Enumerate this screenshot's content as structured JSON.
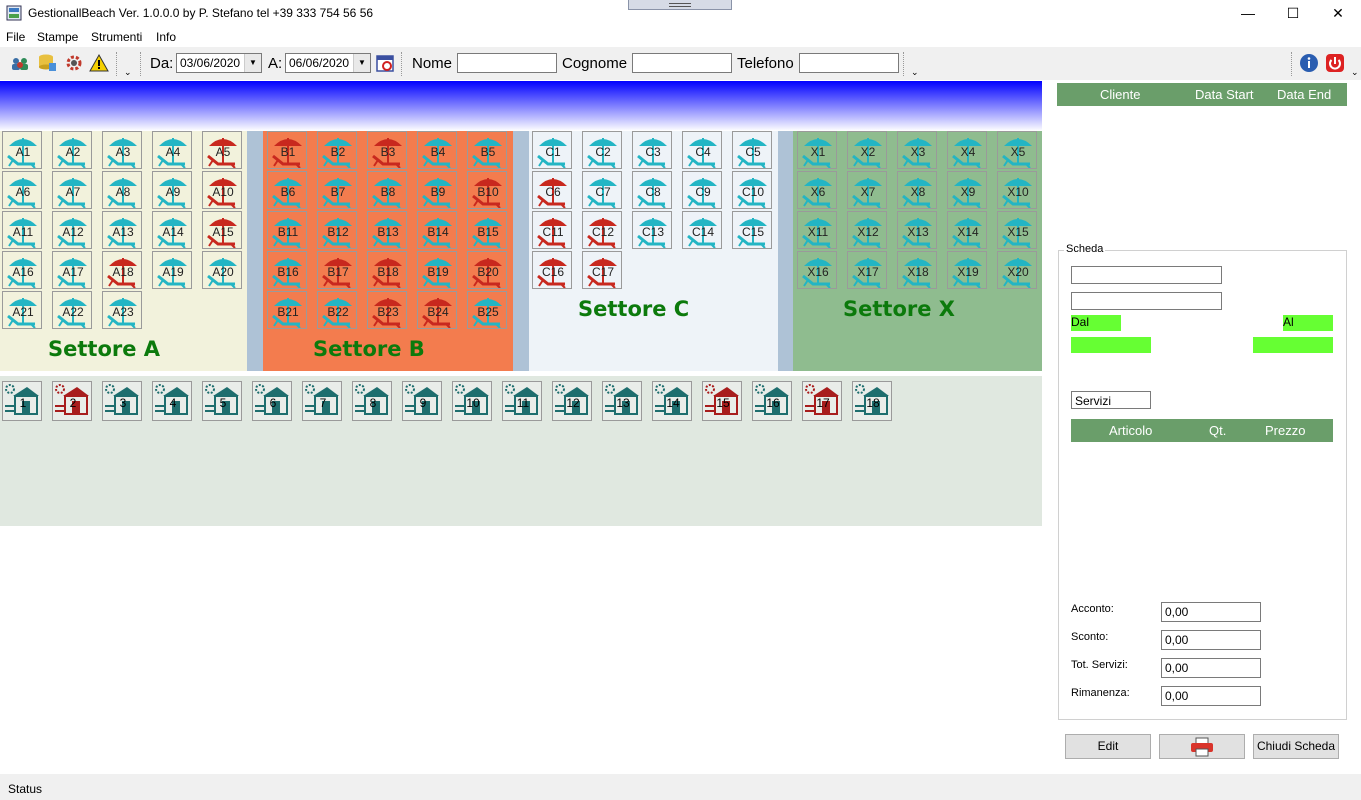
{
  "window": {
    "title": "GestionallBeach Ver. 1.0.0.0 by P. Stefano tel +39 333 754 56 56",
    "minimize": "—",
    "maximize": "☐",
    "close": "✕"
  },
  "menu": [
    "File",
    "Stampe",
    "Strumenti",
    "Info"
  ],
  "toolbar": {
    "da_label": "Da:",
    "da_value": "03/06/2020",
    "a_label": "A:",
    "a_value": "06/06/2020",
    "nome_label": "Nome",
    "cognome_label": "Cognome",
    "telefono_label": "Telefono",
    "nome_value": "",
    "cognome_value": "",
    "telefono_value": ""
  },
  "sectors": [
    {
      "key": "A",
      "label": "Settore A",
      "bg": "#f2f2dc",
      "rows": [
        [
          "A1",
          "A2",
          "A3",
          "A4",
          "A5"
        ],
        [
          "A6",
          "A7",
          "A8",
          "A9",
          "A10"
        ],
        [
          "A11",
          "A12",
          "A13",
          "A14",
          "A15"
        ],
        [
          "A16",
          "A17",
          "A18",
          "A19",
          "A20"
        ],
        [
          "A21",
          "A22",
          "A23"
        ]
      ],
      "occupied": [
        "A5",
        "A10",
        "A15",
        "A18"
      ]
    },
    {
      "key": "B",
      "label": "Settore B",
      "bg": "#f37c4e",
      "rows": [
        [
          "B1",
          "B2",
          "B3",
          "B4",
          "B5"
        ],
        [
          "B6",
          "B7",
          "B8",
          "B9",
          "B10"
        ],
        [
          "B11",
          "B12",
          "B13",
          "B14",
          "B15"
        ],
        [
          "B16",
          "B17",
          "B18",
          "B19",
          "B20"
        ],
        [
          "B21",
          "B22",
          "B23",
          "B24",
          "B25"
        ]
      ],
      "occupied": [
        "B1",
        "B3",
        "B10",
        "B17",
        "B18",
        "B20",
        "B23",
        "B24"
      ]
    },
    {
      "key": "C",
      "label": "Settore C",
      "bg": "#eef3f8",
      "rows": [
        [
          "C1",
          "C2",
          "C3",
          "C4",
          "C5"
        ],
        [
          "C6",
          "C7",
          "C8",
          "C9",
          "C10"
        ],
        [
          "C11",
          "C12",
          "C13",
          "C14",
          "C15"
        ],
        [
          "C16",
          "C17"
        ]
      ],
      "occupied": [
        "C6",
        "C11",
        "C12",
        "C16",
        "C17"
      ]
    },
    {
      "key": "X",
      "label": "Settore X",
      "bg": "#8fbc8f",
      "rows": [
        [
          "X1",
          "X2",
          "X3",
          "X4",
          "X5"
        ],
        [
          "X6",
          "X7",
          "X8",
          "X9",
          "X10"
        ],
        [
          "X11",
          "X12",
          "X13",
          "X14",
          "X15"
        ],
        [
          "X16",
          "X17",
          "X18",
          "X19",
          "X20"
        ]
      ],
      "occupied": []
    }
  ],
  "cabins": {
    "labels": [
      "1",
      "2",
      "3",
      "4",
      "5",
      "6",
      "7",
      "8",
      "9",
      "10",
      "11",
      "12",
      "13",
      "14",
      "15",
      "16",
      "17",
      "18"
    ],
    "occupied": [
      "2",
      "15",
      "17"
    ]
  },
  "reservations": {
    "columns": [
      "Cliente",
      "Data Start",
      "Data End"
    ]
  },
  "scheda": {
    "title": "Scheda",
    "field1": "",
    "field2": "",
    "dal_label": "Dal",
    "al_label": "Al",
    "dal_value": "",
    "al_value": "",
    "servizi_value": "Servizi",
    "articles_columns": [
      "Articolo",
      "Qt.",
      "Prezzo"
    ],
    "acconto_label": "Acconto:",
    "acconto_value": "0,00",
    "sconto_label": "Sconto:",
    "sconto_value": "0,00",
    "tot_servizi_label": "Tot. Servizi:",
    "tot_servizi_value": "0,00",
    "rimanenza_label": "Rimanenza:",
    "rimanenza_value": "0,00"
  },
  "buttons": {
    "edit": "Edit",
    "chiudi": "Chiudi Scheda"
  },
  "status": {
    "text": "Status"
  },
  "colors": {
    "free": "#23b5c4",
    "occupied": "#c8281e",
    "header_green": "#6a9e6a",
    "field_green": "#66ff33"
  }
}
